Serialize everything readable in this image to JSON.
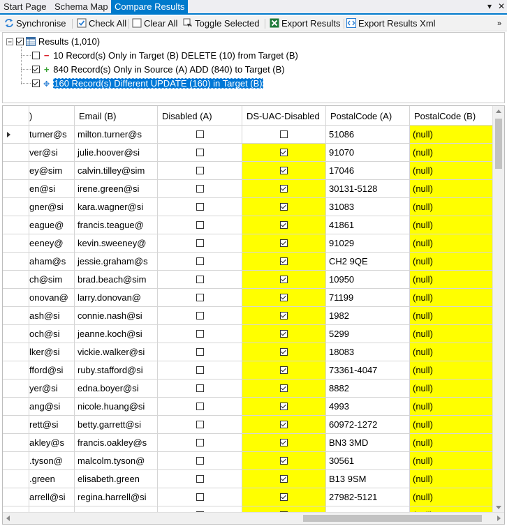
{
  "tabs": [
    "Start Page",
    "Schema Map",
    "Compare Results"
  ],
  "tab_controls": {
    "dropdown": "▾",
    "close": "✕"
  },
  "toolbar": {
    "synchronise": "Synchronise",
    "check_all": "Check All",
    "clear_all": "Clear All",
    "toggle_selected": "Toggle Selected",
    "export_results": "Export Results",
    "export_results_xml": "Export Results Xml"
  },
  "tree": {
    "root": {
      "label": "Results (1,010)",
      "checked": true
    },
    "children": [
      {
        "label": "10 Record(s) Only in Target (B) DELETE (10) from Target (B)",
        "checked": false,
        "icon": "minus-icon",
        "color": "#d9202a"
      },
      {
        "label": "840 Record(s) Only in Source (A) ADD (840) to Target (B)",
        "checked": true,
        "icon": "plus-icon",
        "color": "#3aa335"
      },
      {
        "label": "160 Record(s) Different UPDATE (160) in Target (B)",
        "checked": true,
        "icon": "update-icon",
        "color": "#2a7fd4",
        "selected": true
      }
    ]
  },
  "grid": {
    "columns": [
      "Email (A)",
      "Email (B)",
      "Disabled (A)",
      "DS-UAC-Disabled",
      "PostalCode (A)",
      "PostalCode (B)"
    ],
    "first_col_visible": ")",
    "highlight_color": "#ffff00",
    "rows": [
      {
        "email_a": "turner@s",
        "email_b": "milton.turner@s",
        "disabled_a": false,
        "ds_uac": false,
        "ds_diff": false,
        "postal_a": "51086",
        "postal_b": "(null)"
      },
      {
        "email_a": "ver@si",
        "email_b": "julie.hoover@si",
        "disabled_a": false,
        "ds_uac": true,
        "ds_diff": true,
        "postal_a": "91070",
        "postal_b": "(null)"
      },
      {
        "email_a": "ey@sim",
        "email_b": "calvin.tilley@sim",
        "disabled_a": false,
        "ds_uac": true,
        "ds_diff": true,
        "postal_a": "17046",
        "postal_b": "(null)"
      },
      {
        "email_a": "en@si",
        "email_b": "irene.green@si",
        "disabled_a": false,
        "ds_uac": true,
        "ds_diff": true,
        "postal_a": "30131-5128",
        "postal_b": "(null)"
      },
      {
        "email_a": "gner@si",
        "email_b": "kara.wagner@si",
        "disabled_a": false,
        "ds_uac": true,
        "ds_diff": true,
        "postal_a": "31083",
        "postal_b": "(null)"
      },
      {
        "email_a": "eague@",
        "email_b": "francis.teague@",
        "disabled_a": false,
        "ds_uac": true,
        "ds_diff": true,
        "postal_a": "41861",
        "postal_b": "(null)"
      },
      {
        "email_a": "eeney@",
        "email_b": "kevin.sweeney@",
        "disabled_a": false,
        "ds_uac": true,
        "ds_diff": true,
        "postal_a": "91029",
        "postal_b": "(null)"
      },
      {
        "email_a": "aham@s",
        "email_b": "jessie.graham@s",
        "disabled_a": false,
        "ds_uac": true,
        "ds_diff": true,
        "postal_a": "CH2 9QE",
        "postal_b": "(null)"
      },
      {
        "email_a": "ch@sim",
        "email_b": "brad.beach@sim",
        "disabled_a": false,
        "ds_uac": true,
        "ds_diff": true,
        "postal_a": "10950",
        "postal_b": "(null)"
      },
      {
        "email_a": "onovan@",
        "email_b": "larry.donovan@",
        "disabled_a": false,
        "ds_uac": true,
        "ds_diff": true,
        "postal_a": "71199",
        "postal_b": "(null)"
      },
      {
        "email_a": "ash@si",
        "email_b": "connie.nash@si",
        "disabled_a": false,
        "ds_uac": true,
        "ds_diff": true,
        "postal_a": "1982",
        "postal_b": "(null)"
      },
      {
        "email_a": "och@si",
        "email_b": "jeanne.koch@si",
        "disabled_a": false,
        "ds_uac": true,
        "ds_diff": true,
        "postal_a": "5299",
        "postal_b": "(null)"
      },
      {
        "email_a": "lker@si",
        "email_b": "vickie.walker@si",
        "disabled_a": false,
        "ds_uac": true,
        "ds_diff": true,
        "postal_a": "18083",
        "postal_b": "(null)"
      },
      {
        "email_a": "fford@si",
        "email_b": "ruby.stafford@si",
        "disabled_a": false,
        "ds_uac": true,
        "ds_diff": true,
        "postal_a": "73361-4047",
        "postal_b": "(null)"
      },
      {
        "email_a": "yer@si",
        "email_b": "edna.boyer@si",
        "disabled_a": false,
        "ds_uac": true,
        "ds_diff": true,
        "postal_a": "8882",
        "postal_b": "(null)"
      },
      {
        "email_a": "ang@si",
        "email_b": "nicole.huang@si",
        "disabled_a": false,
        "ds_uac": true,
        "ds_diff": true,
        "postal_a": "4993",
        "postal_b": "(null)"
      },
      {
        "email_a": "rett@si",
        "email_b": "betty.garrett@si",
        "disabled_a": false,
        "ds_uac": true,
        "ds_diff": true,
        "postal_a": "60972-1272",
        "postal_b": "(null)"
      },
      {
        "email_a": "akley@s",
        "email_b": "francis.oakley@s",
        "disabled_a": false,
        "ds_uac": true,
        "ds_diff": true,
        "postal_a": "BN3 3MD",
        "postal_b": "(null)"
      },
      {
        "email_a": ".tyson@",
        "email_b": "malcolm.tyson@",
        "disabled_a": false,
        "ds_uac": true,
        "ds_diff": true,
        "postal_a": "30561",
        "postal_b": "(null)"
      },
      {
        "email_a": ".green",
        "email_b": "elisabeth.green",
        "disabled_a": false,
        "ds_uac": true,
        "ds_diff": true,
        "postal_a": "B13 9SM",
        "postal_b": "(null)"
      },
      {
        "email_a": "arrell@si",
        "email_b": "regina.harrell@si",
        "disabled_a": false,
        "ds_uac": true,
        "ds_diff": true,
        "postal_a": "27982-5121",
        "postal_b": "(null)"
      },
      {
        "email_a": "",
        "email_b": "",
        "disabled_a": false,
        "ds_uac": true,
        "ds_diff": true,
        "postal_a": "",
        "postal_b": "(null)"
      }
    ]
  }
}
